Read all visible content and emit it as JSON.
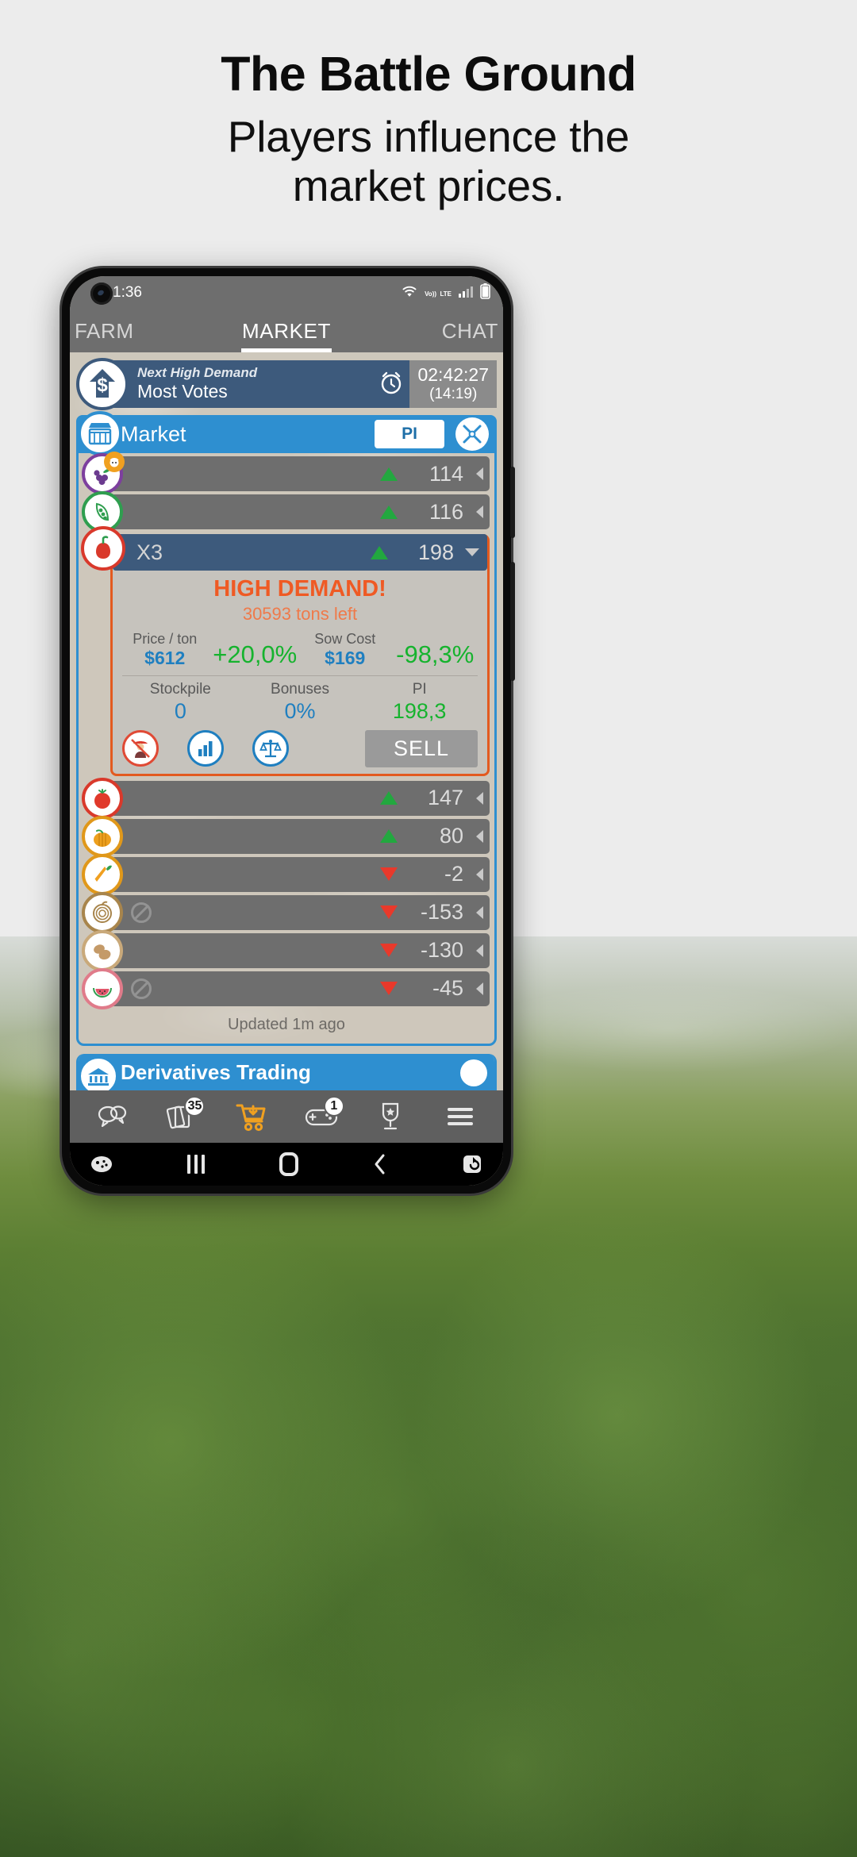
{
  "promo": {
    "title": "The Battle Ground",
    "subtitle_line1": "Players influence the",
    "subtitle_line2": "market prices."
  },
  "statusbar": {
    "time": "1:36",
    "icons": [
      "wifi-icon",
      "volte-icon",
      "signal-icon",
      "battery-icon"
    ],
    "volte_top": "Vo))",
    "volte_bottom": "LTE"
  },
  "tabs": [
    {
      "label": "FARM",
      "active": false
    },
    {
      "label": "MARKET",
      "active": true
    },
    {
      "label": "CHAT",
      "active": false
    }
  ],
  "high_demand_banner": {
    "icon": "dollar-arrow-up-icon",
    "label": "Next High Demand",
    "value": "Most Votes",
    "clock_icon": "alarm-clock-icon",
    "timer": "02:42:27",
    "timer_secondary": "(14:19)"
  },
  "market": {
    "icon": "market-stall-icon",
    "title": "Market",
    "pi_button": "PI",
    "tools_icon": "tools-icon",
    "updated": "Updated 1m ago",
    "rows": [
      {
        "name": "grapes",
        "icon": "grapes-icon",
        "color_class": "c-purple",
        "badge_icon": "character-badge-icon",
        "value": "114",
        "direction": "up",
        "blocked": false
      },
      {
        "name": "peas",
        "icon": "peapod-icon",
        "color_class": "c-green",
        "badge_icon": "",
        "value": "116",
        "direction": "up",
        "blocked": false
      },
      {
        "name": "tomato",
        "icon": "tomato-icon",
        "color_class": "c-red",
        "badge_icon": "",
        "value": "147",
        "direction": "up",
        "blocked": false
      },
      {
        "name": "pumpkin",
        "icon": "pumpkin-icon",
        "color_class": "c-orange",
        "badge_icon": "",
        "value": "80",
        "direction": "up",
        "blocked": false
      },
      {
        "name": "carrot",
        "icon": "carrot-icon",
        "color_class": "c-orange",
        "badge_icon": "",
        "value": "-2",
        "direction": "down",
        "blocked": false
      },
      {
        "name": "onion",
        "icon": "onion-icon",
        "color_class": "c-brown",
        "badge_icon": "",
        "value": "-153",
        "direction": "down",
        "blocked": true
      },
      {
        "name": "potato",
        "icon": "potato-icon",
        "color_class": "c-tan",
        "badge_icon": "",
        "value": "-130",
        "direction": "down",
        "blocked": false
      },
      {
        "name": "watermelon",
        "icon": "watermelon-icon",
        "color_class": "c-pink",
        "badge_icon": "",
        "value": "-45",
        "direction": "down",
        "blocked": true
      }
    ]
  },
  "expanded_card": {
    "icon": "pepper-icon",
    "multiplier": "X3",
    "header_value": "198",
    "header_direction": "up",
    "banner_title": "HIGH DEMAND!",
    "tons_left": "30593 tons left",
    "price_label": "Price / ton",
    "price_value": "$612",
    "price_change": "+20,0%",
    "sow_label": "Sow Cost",
    "sow_value": "$169",
    "sow_change": "-98,3%",
    "stockpile_label": "Stockpile",
    "stockpile_value": "0",
    "bonuses_label": "Bonuses",
    "bonuses_value": "0%",
    "pi_label": "PI",
    "pi_value": "198,3",
    "action_icons": [
      "farmer-blocked-icon",
      "bar-chart-icon",
      "scales-icon"
    ],
    "sell_button": "SELL"
  },
  "derivatives": {
    "icon": "bank-icon",
    "title": "Derivatives Trading"
  },
  "app_nav": [
    {
      "name": "chat",
      "icon": "chat-bubbles-icon",
      "badge": "",
      "active": false
    },
    {
      "name": "cards",
      "icon": "cards-icon",
      "badge": "35",
      "active": false
    },
    {
      "name": "shop",
      "icon": "cart-download-icon",
      "badge": "",
      "active": true
    },
    {
      "name": "games",
      "icon": "gamepad-plus-icon",
      "badge": "1",
      "active": false
    },
    {
      "name": "leaderboard",
      "icon": "trophy-icon",
      "badge": "",
      "active": false
    },
    {
      "name": "menu",
      "icon": "hamburger-menu-icon",
      "badge": "",
      "active": false
    }
  ],
  "system_nav": [
    {
      "name": "game-launcher",
      "icon": "game-launcher-icon"
    },
    {
      "name": "recents",
      "icon": "recents-icon"
    },
    {
      "name": "home",
      "icon": "home-icon"
    },
    {
      "name": "back",
      "icon": "back-chevron-icon"
    },
    {
      "name": "screenshot",
      "icon": "screenshot-icon"
    }
  ],
  "colors": {
    "accent_blue": "#2e8fd0",
    "panel_blue": "#3d5a7c",
    "orange": "#e35a1f",
    "green_up": "#22a83f",
    "red_down": "#e8392b",
    "nav_active": "#f0a020"
  }
}
